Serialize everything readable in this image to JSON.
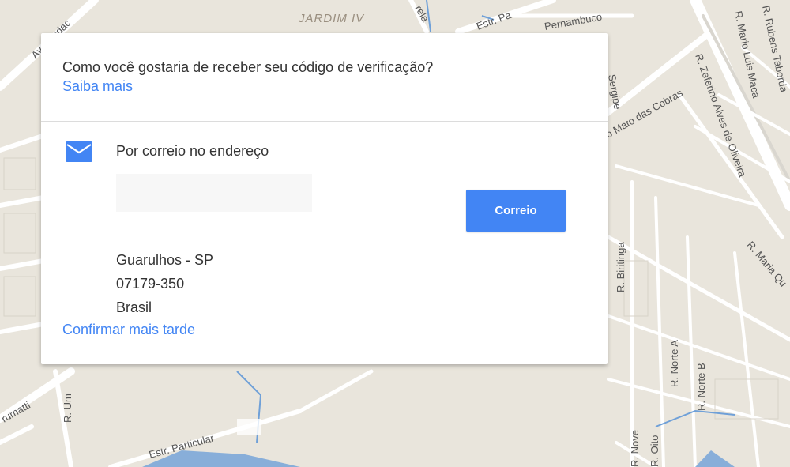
{
  "map": {
    "labels": {
      "district": "JARDIM IV",
      "street_pernambuco": "Pernambuco",
      "street_estr_pa": "Estr. Pa",
      "street_rela": "rela",
      "street_mato_cobras": "o Mato das Cobras",
      "street_sergipe": "Sergipe",
      "street_zeferino": "R. Zeferino Alves de Oliveira",
      "street_mario_luis": "R. Mario Luis Maca",
      "street_rubens": "R. Rubens Taborda",
      "street_maria_qu": "R. Maria Qu",
      "street_biritinga": "R. Biritinga",
      "street_norte_a": "R. Norte A",
      "street_norte_b": "R. Norte B",
      "street_nove": "R. Nove",
      "street_oito": "R. Oito",
      "street_um": "R. Um",
      "street_estr_particular": "Estr. Particular",
      "street_brumatti": "rumatti",
      "street_av_agedac": "Av. agedac"
    },
    "colors": {
      "background": "#e9e5dc",
      "road": "#ffffff",
      "water": "#6fa0d8"
    }
  },
  "dialog": {
    "question": "Como você gostaria de receber seu código de verificação?",
    "learn_more": "Saiba mais",
    "option": {
      "icon": "mail-icon",
      "title": "Por correio no endereço",
      "address_lines": [
        "Guarulhos - SP",
        "07179-350",
        "Brasil"
      ],
      "button_label": "Correio"
    },
    "confirm_later": "Confirmar mais tarde",
    "colors": {
      "accent": "#4285f4",
      "text": "#333333"
    }
  }
}
